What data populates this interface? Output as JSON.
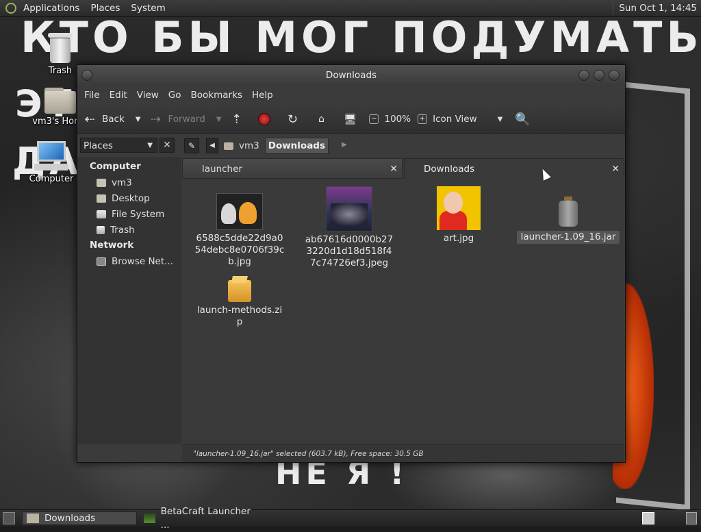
{
  "top_panel": {
    "menus": [
      "Applications",
      "Places",
      "System"
    ],
    "clock": "Sun Oct 1, 14:45"
  },
  "wallpaper": {
    "text_top": "КТО БЫ МОГ ПОДУМАТЬ, ЧТО Я -",
    "text_mid1": "ЭТО",
    "text_mid2": "ДА",
    "text_bottom": "НЕ Я !"
  },
  "desktop_icons": {
    "trash": "Trash",
    "home": "vm3's Home",
    "computer": "Computer"
  },
  "window": {
    "title": "Downloads",
    "menubar": [
      "File",
      "Edit",
      "View",
      "Go",
      "Bookmarks",
      "Help"
    ],
    "toolbar": {
      "back": "Back",
      "forward": "Forward",
      "zoom": "100%",
      "view_mode": "Icon View"
    },
    "sidebar_combo": "Places",
    "path": [
      "vm3",
      "Downloads"
    ],
    "sidebar": {
      "computer_heading": "Computer",
      "computer_items": [
        "vm3",
        "Desktop",
        "File System",
        "Trash"
      ],
      "network_heading": "Network",
      "network_items": [
        "Browse Net..."
      ]
    },
    "tabs": [
      "launcher",
      "Downloads"
    ],
    "files": [
      {
        "name": "6588c5dde22d9a054debc8e0706f39cb.jpg"
      },
      {
        "name": "ab67616d0000b273220d1d18d518f47c74726ef3.jpeg"
      },
      {
        "name": "art.jpg"
      },
      {
        "name": "launcher-1.09_16.jar"
      },
      {
        "name": "launch-methods.zip"
      }
    ],
    "status": "\"launcher-1.09_16.jar\" selected (603.7 kB), Free space: 30.5 GB"
  },
  "taskbar": {
    "tasks": [
      "Downloads",
      "BetaCraft Launcher ..."
    ]
  }
}
